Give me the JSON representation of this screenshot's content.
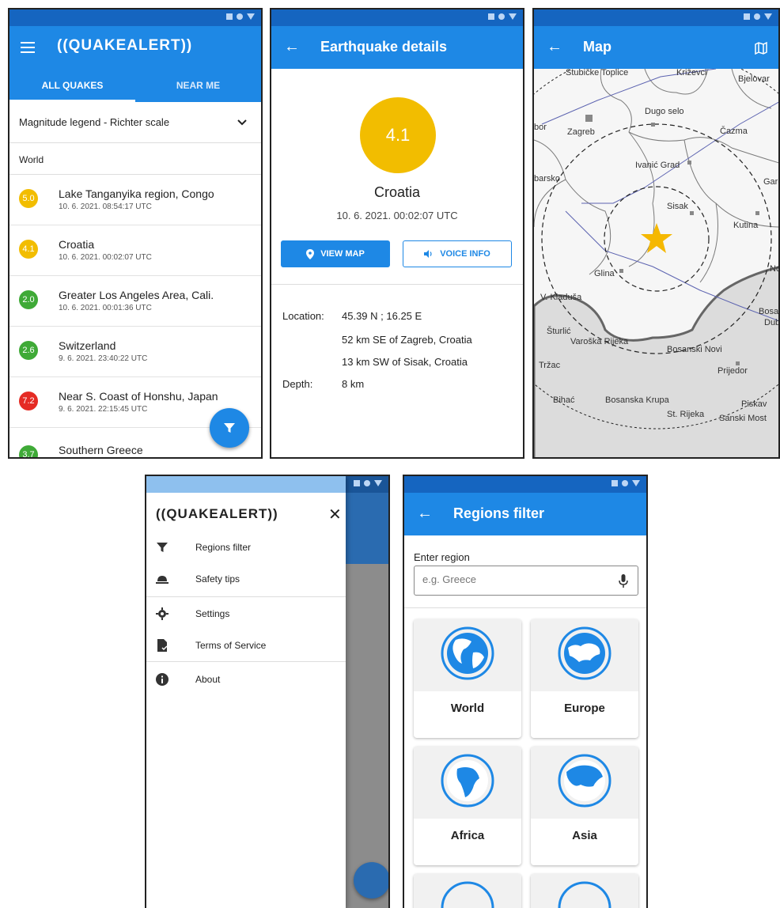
{
  "colors": {
    "primary": "#1e88e5",
    "status_bar": "#1565c0",
    "mag_yellow": "#f2bd00",
    "mag_green": "#3faa37",
    "mag_red": "#e52b24"
  },
  "list_screen": {
    "app_logo": "((QUAKEALERT))",
    "tabs": [
      {
        "label": "ALL QUAKES",
        "active": true
      },
      {
        "label": "NEAR ME",
        "active": false
      }
    ],
    "legend_label": "Magnitude legend - Richter scale",
    "region_label": "World",
    "quakes": [
      {
        "mag": "5.0",
        "color": "yellow",
        "place": "Lake Tanganyika region, Congo",
        "time": "10. 6. 2021.  08:54:17 UTC"
      },
      {
        "mag": "4.1",
        "color": "yellow",
        "place": "Croatia",
        "time": "10. 6. 2021.  00:02:07 UTC"
      },
      {
        "mag": "2.0",
        "color": "green",
        "place": "Greater Los Angeles Area, Cali.",
        "time": "10. 6. 2021.  00:01:36 UTC"
      },
      {
        "mag": "2.6",
        "color": "green",
        "place": "Switzerland",
        "time": "9. 6. 2021.  23:40:22 UTC"
      },
      {
        "mag": "7.2",
        "color": "red",
        "place": "Near S. Coast of Honshu, Japan",
        "time": "9. 6. 2021.  22:15:45 UTC"
      },
      {
        "mag": "3.7",
        "color": "green",
        "place": "Southern Greece",
        "time": ""
      }
    ],
    "fab_icon": "filter-icon"
  },
  "details_screen": {
    "title": "Earthquake details",
    "magnitude": "4.1",
    "place": "Croatia",
    "time": "10. 6. 2021.  00:02:07 UTC",
    "view_map_label": "VIEW MAP",
    "voice_info_label": "VOICE INFO",
    "location_label": "Location:",
    "location_values": [
      "45.39 N ; 16.25 E",
      "52 km SE of Zagreb, Croatia",
      "13 km SW of Sisak, Croatia"
    ],
    "depth_label": "Depth:",
    "depth_value": "8 km"
  },
  "map_screen": {
    "title": "Map",
    "places": [
      "Stubičke Toplice",
      "Križevci",
      "Bjelovar",
      "Dugo selo",
      "bor",
      "Zagreb",
      "Čazma",
      "Ivanić Grad",
      "barsko",
      "Gare",
      "Sisak",
      "Kutina",
      "Glina",
      "No",
      "V. Kladuša",
      "Bosa",
      "Dub",
      "Šturlić",
      "Varoška Rijeka",
      "Bosanski Novi",
      "Tržac",
      "Prijedor",
      "Bihać",
      "Bosanska Krupa",
      "St. Rijeka",
      "Piskav",
      "Sanski Most"
    ]
  },
  "drawer_screen": {
    "logo": "((QUAKEALERT))",
    "items": [
      {
        "label": "Regions filter",
        "icon": "filter-icon"
      },
      {
        "label": "Safety tips",
        "icon": "helmet-icon"
      },
      {
        "label": "Settings",
        "icon": "gear-icon"
      },
      {
        "label": "Terms of Service",
        "icon": "document-icon"
      },
      {
        "label": "About",
        "icon": "info-icon"
      }
    ]
  },
  "regions_screen": {
    "title": "Regions filter",
    "input_label": "Enter region",
    "input_placeholder": "e.g. Greece",
    "regions": [
      "World",
      "Europe",
      "Africa",
      "Asia"
    ]
  }
}
